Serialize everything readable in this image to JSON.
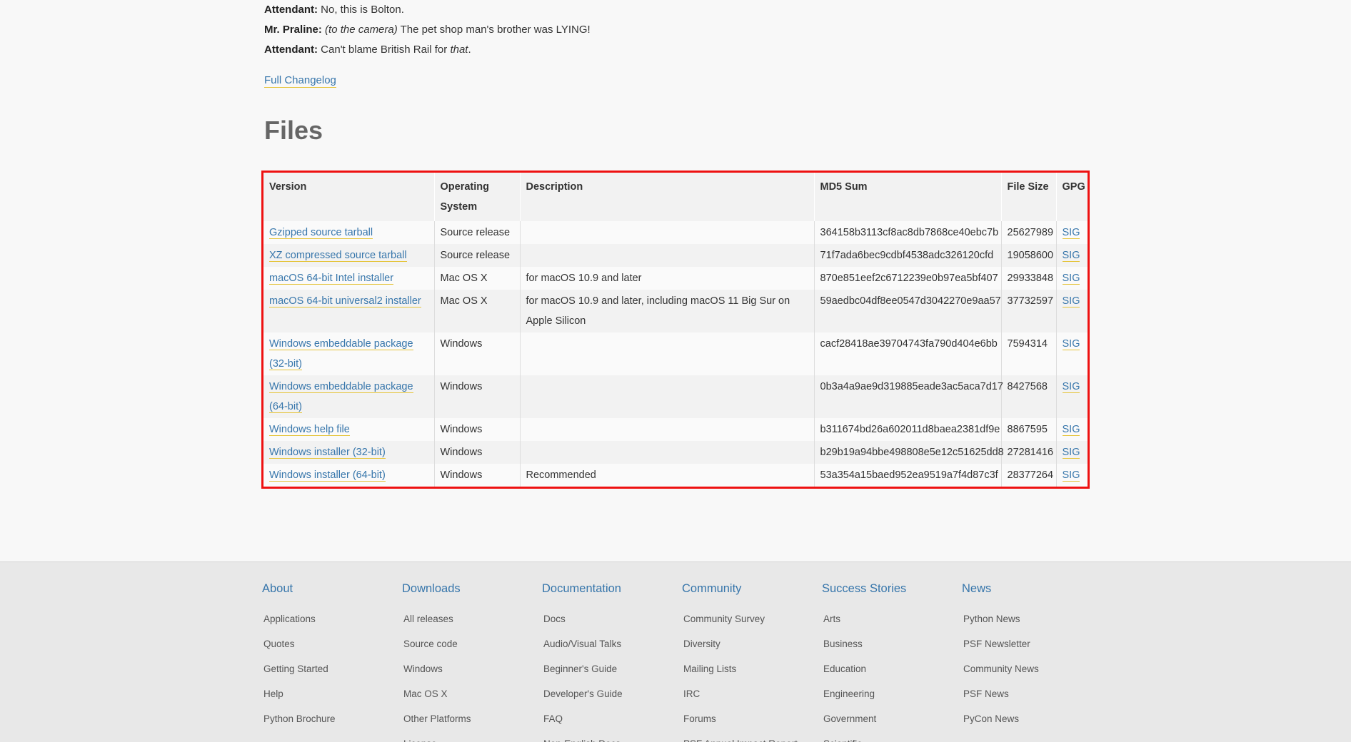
{
  "dialogue": [
    {
      "speaker": "Attendant:",
      "pre": "",
      "em": "",
      "text": "No, this is Bolton.",
      "em_after": "",
      "after": ""
    },
    {
      "speaker": "Mr. Praline:",
      "pre": "",
      "em": "(to the camera)",
      "text": " The pet shop man's brother was LYING!",
      "em_after": "",
      "after": ""
    },
    {
      "speaker": "Attendant:",
      "pre": "",
      "em": "",
      "text": "Can't blame British Rail for ",
      "em_after": "that",
      "after": "."
    }
  ],
  "changelog_label": "Full Changelog",
  "files_heading": "Files",
  "table": {
    "headers": {
      "version": "Version",
      "os": "Operating System",
      "description": "Description",
      "md5": "MD5 Sum",
      "size": "File Size",
      "gpg": "GPG"
    },
    "rows": [
      {
        "version": "Gzipped source tarball",
        "os": "Source release",
        "description": "",
        "md5": "364158b3113cf8ac8db7868ce40ebc7b",
        "size": "25627989",
        "gpg": "SIG"
      },
      {
        "version": "XZ compressed source tarball",
        "os": "Source release",
        "description": "",
        "md5": "71f7ada6bec9cdbf4538adc326120cfd",
        "size": "19058600",
        "gpg": "SIG"
      },
      {
        "version": "macOS 64-bit Intel installer",
        "os": "Mac OS X",
        "description": "for macOS 10.9 and later",
        "md5": "870e851eef2c6712239e0b97ea5bf407",
        "size": "29933848",
        "gpg": "SIG"
      },
      {
        "version": "macOS 64-bit universal2 installer",
        "os": "Mac OS X",
        "description": "for macOS 10.9 and later, including macOS 11 Big Sur on Apple Silicon",
        "md5": "59aedbc04df8ee0547d3042270e9aa57",
        "size": "37732597",
        "gpg": "SIG"
      },
      {
        "version": "Windows embeddable package (32-bit)",
        "os": "Windows",
        "description": "",
        "md5": "cacf28418ae39704743fa790d404e6bb",
        "size": "7594314",
        "gpg": "SIG"
      },
      {
        "version": "Windows embeddable package (64-bit)",
        "os": "Windows",
        "description": "",
        "md5": "0b3a4a9ae9d319885eade3ac5aca7d17",
        "size": "8427568",
        "gpg": "SIG"
      },
      {
        "version": "Windows help file",
        "os": "Windows",
        "description": "",
        "md5": "b311674bd26a602011d8baea2381df9e",
        "size": "8867595",
        "gpg": "SIG"
      },
      {
        "version": "Windows installer (32-bit)",
        "os": "Windows",
        "description": "",
        "md5": "b29b19a94bbe498808e5e12c51625dd8",
        "size": "27281416",
        "gpg": "SIG"
      },
      {
        "version": "Windows installer (64-bit)",
        "os": "Windows",
        "description": "Recommended",
        "md5": "53a354a15baed952ea9519a7f4d87c3f",
        "size": "28377264",
        "gpg": "SIG"
      }
    ]
  },
  "footer": {
    "columns": [
      {
        "title": "About",
        "items": [
          "Applications",
          "Quotes",
          "Getting Started",
          "Help",
          "Python Brochure"
        ]
      },
      {
        "title": "Downloads",
        "items": [
          "All releases",
          "Source code",
          "Windows",
          "Mac OS X",
          "Other Platforms",
          "License"
        ]
      },
      {
        "title": "Documentation",
        "items": [
          "Docs",
          "Audio/Visual Talks",
          "Beginner's Guide",
          "Developer's Guide",
          "FAQ",
          "Non-English Docs"
        ]
      },
      {
        "title": "Community",
        "items": [
          "Community Survey",
          "Diversity",
          "Mailing Lists",
          "IRC",
          "Forums",
          "PSF Annual Impact Report"
        ]
      },
      {
        "title": "Success Stories",
        "items": [
          "Arts",
          "Business",
          "Education",
          "Engineering",
          "Government",
          "Scientific"
        ]
      },
      {
        "title": "News",
        "items": [
          "Python News",
          "PSF Newsletter",
          "Community News",
          "PSF News",
          "PyCon News"
        ]
      }
    ]
  },
  "colors": {
    "link": "#3776ab",
    "highlight_border": "#ee1111",
    "link_underline": "#e5c43a"
  }
}
